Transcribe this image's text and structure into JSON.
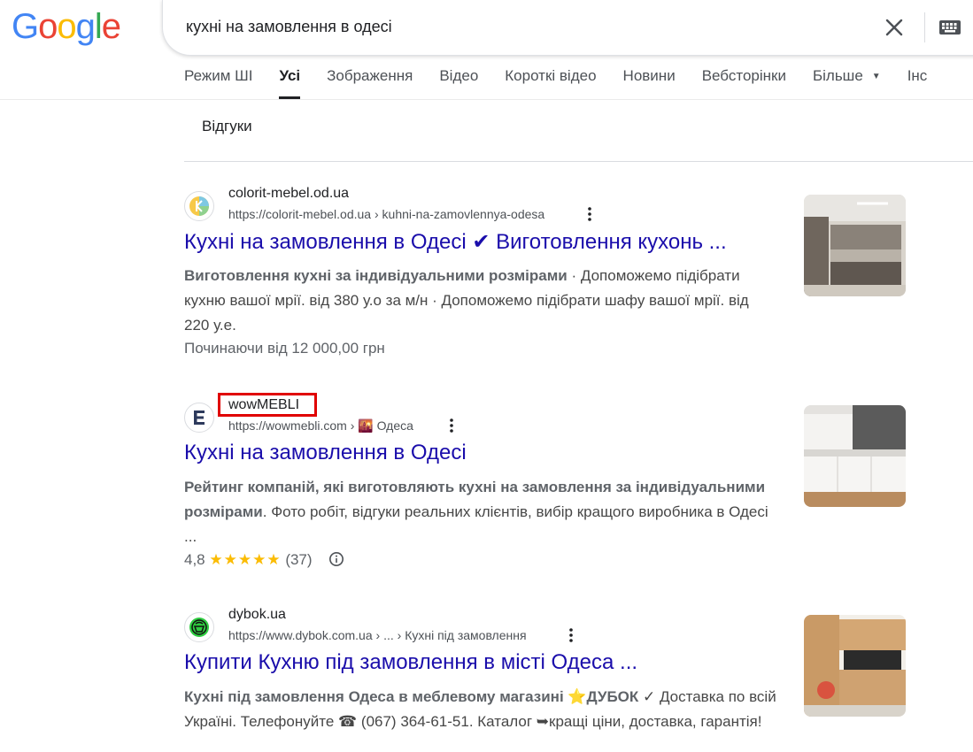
{
  "logo": {
    "letters": [
      "G",
      "o",
      "o",
      "g",
      "l",
      "e"
    ],
    "colors": [
      "#4285F4",
      "#EA4335",
      "#FBBC05",
      "#4285F4",
      "#34A853",
      "#EA4335"
    ]
  },
  "search": {
    "query": "кухні на замовлення в одесі"
  },
  "tabs": [
    {
      "label": "Режим ШІ"
    },
    {
      "label": "Усі",
      "active": true
    },
    {
      "label": "Зображення"
    },
    {
      "label": "Відео"
    },
    {
      "label": "Короткі відео"
    },
    {
      "label": "Новини"
    },
    {
      "label": "Вебсторінки"
    },
    {
      "label": "Більше"
    },
    {
      "label": "Інс"
    }
  ],
  "chips": [
    {
      "label": "Відгуки"
    }
  ],
  "results": [
    {
      "site_name": "colorit-mebel.od.ua",
      "url": "https://colorit-mebel.od.ua",
      "url_path": " › kuhni-na-zamovlennya-odesa",
      "title": "Кухні на замовлення в Одесі ✔ Виготовлення кухонь ...",
      "snippet_bold": "Виготовлення кухні за індивідуальними розмірами",
      "snippet_rest": " · Допоможемо підібрати кухню вашої мрії. від 380 у.о за м/н · Допоможемо підібрати шафу вашої мрії. від 220 у.е.",
      "extra": "Починаючи від 12 000,00 грн"
    },
    {
      "site_name": "wowMEBLI",
      "url": "https://wowmebli.com",
      "url_path": " › 🌇 Одеса",
      "title": "Кухні на замовлення в Одесі",
      "snippet_bold": "Рейтинг компаній, які виготовляють кухні на замовлення за індивідуальними розмірами",
      "snippet_rest": ". Фото робіт, відгуки реальних клієнтів, вибір кращого виробника в Одесі ...",
      "rating": "4,8",
      "stars": "★★★★★",
      "rating_count": "(37)"
    },
    {
      "site_name": "dybok.ua",
      "url": "https://www.dybok.com.ua",
      "url_path": " › ... › Кухні під замовлення",
      "title": "Купити Кухню під замовлення в місті Одеса ...",
      "snippet_bold": "Кухні під замовлення Одеса в меблевому магазині ⭐ДУБОК",
      "snippet_rest": " ✓ Доставка по всій Україні. Телефонуйте ☎ (067) 364-61-51. Каталог ➥кращі ціни, доставка, гарантія!"
    }
  ]
}
